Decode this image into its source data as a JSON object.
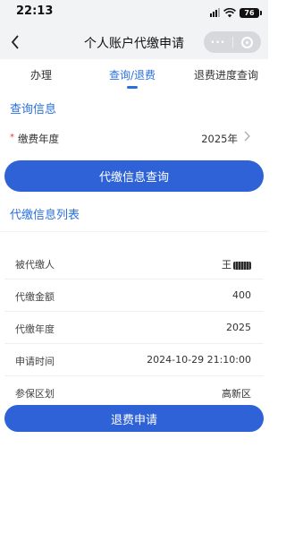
{
  "status_bar": {
    "time": "22:13",
    "battery": "76"
  },
  "nav": {
    "title": "个人账户代缴申请",
    "more_label": "···"
  },
  "tabs": [
    {
      "label": "办理",
      "active": false
    },
    {
      "label": "查询/退费",
      "active": true
    },
    {
      "label": "退费进度查询",
      "active": false
    }
  ],
  "query_section": {
    "title": "查询信息",
    "year_field": {
      "required_mark": "*",
      "label": "缴费年度",
      "value": "2025年"
    },
    "query_button": "代缴信息查询"
  },
  "list_section": {
    "title": "代缴信息列表",
    "rows": [
      {
        "label": "被代缴人",
        "value": "王"
      },
      {
        "label": "代缴金额",
        "value": "400"
      },
      {
        "label": "代缴年度",
        "value": "2025"
      },
      {
        "label": "申请时间",
        "value": "2024-10-29 21:10:00"
      },
      {
        "label": "参保区划",
        "value": "高新区"
      }
    ],
    "refund_button": "退费申请"
  },
  "colors": {
    "accent": "#2a6fe0",
    "button": "#2e62d6",
    "required": "#ee3344"
  }
}
